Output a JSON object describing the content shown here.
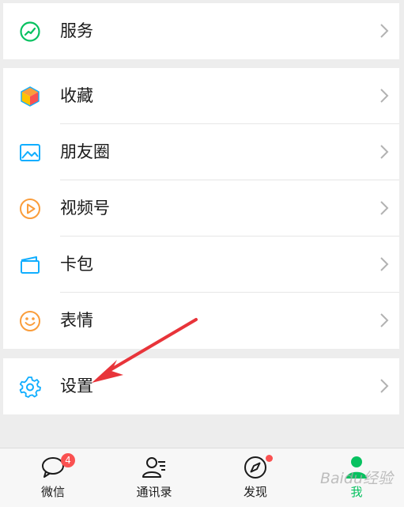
{
  "colors": {
    "accent": "#07c160",
    "badge": "#fa5151",
    "arrow": "#e8343a",
    "background": "#ededed"
  },
  "menu": {
    "services": {
      "label": "服务",
      "icon": "services-icon"
    },
    "favorites": {
      "label": "收藏",
      "icon": "cube-icon"
    },
    "moments": {
      "label": "朋友圈",
      "icon": "picture-icon"
    },
    "channels": {
      "label": "视频号",
      "icon": "play-circle-icon"
    },
    "cards": {
      "label": "卡包",
      "icon": "wallet-icon"
    },
    "stickers": {
      "label": "表情",
      "icon": "smile-icon"
    },
    "settings": {
      "label": "设置",
      "icon": "gear-icon"
    }
  },
  "tabbar": {
    "chats": {
      "label": "微信",
      "badge": "4"
    },
    "contacts": {
      "label": "通讯录"
    },
    "discover": {
      "label": "发现"
    },
    "me": {
      "label": "我"
    }
  },
  "watermark": "Baidu经验"
}
